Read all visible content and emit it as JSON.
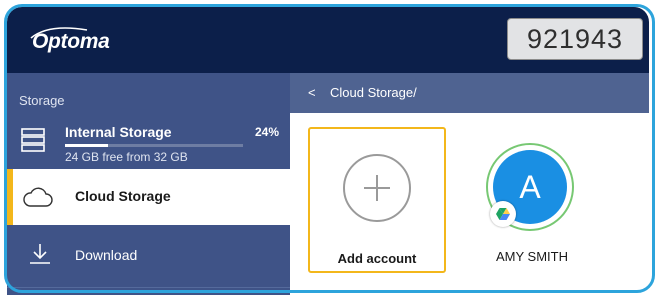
{
  "header": {
    "logo_text": "Optoma",
    "pin_code": "921943",
    "brand_color": "#0c1f4a",
    "frame_color": "#2da4dc"
  },
  "sidebar": {
    "title": "Storage",
    "internal": {
      "label": "Internal Storage",
      "percent_label": "24%",
      "usage_fraction": 0.24,
      "free_text": "24 GB free from 32 GB",
      "icon": "storage-drive-icon"
    },
    "cloud": {
      "label": "Cloud Storage",
      "icon": "cloud-icon",
      "selected": true,
      "accent_color": "#f3b71b"
    },
    "download": {
      "label": "Download",
      "icon": "download-icon"
    },
    "background_color": "#3f5387"
  },
  "pathbar": {
    "back_symbol": "<",
    "path": "Cloud Storage/"
  },
  "content": {
    "add_account": {
      "label": "Add account",
      "icon": "plus-circle-icon"
    },
    "accounts": [
      {
        "name": "AMY SMITH",
        "initial": "A",
        "avatar_color": "#1a8fe3",
        "provider_icon": "google-drive-icon"
      }
    ]
  }
}
